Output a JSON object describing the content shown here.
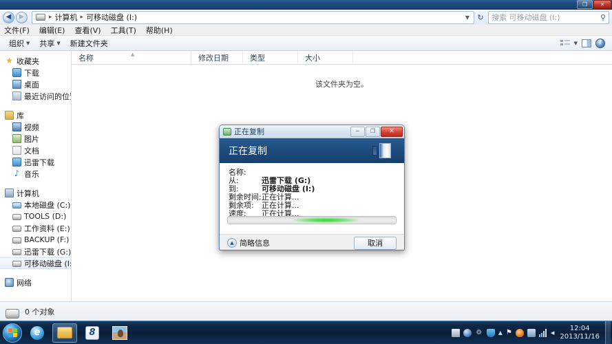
{
  "window": {
    "title": "",
    "controls": {
      "restore": "❐",
      "close": "✕"
    }
  },
  "address": {
    "back_icon": "◀",
    "forward_icon": "▶",
    "drive_icon": "removable-drive-icon",
    "crumbs": [
      "计算机",
      "可移动磁盘 (I:)"
    ],
    "separator": "▸",
    "dropdown_caret": "▼",
    "refresh_icon": "↻"
  },
  "search": {
    "placeholder": "搜索 可移动磁盘 (I:)",
    "icon": "⚲"
  },
  "menubar": {
    "items": [
      "文件(F)",
      "编辑(E)",
      "查看(V)",
      "工具(T)",
      "帮助(H)"
    ]
  },
  "toolbar": {
    "organize": "组织",
    "share": "共享",
    "new_folder": "新建文件夹",
    "caret": "▼",
    "help_glyph": "?"
  },
  "sidebar": {
    "groups": [
      {
        "header": "收藏夹",
        "items": [
          "下载",
          "桌面",
          "最近访问的位置"
        ]
      },
      {
        "header": "库",
        "items": [
          "视频",
          "图片",
          "文档",
          "迅雷下载",
          "音乐"
        ]
      },
      {
        "header": "计算机",
        "items": [
          "本地磁盘 (C:)",
          "TOOLS (D:)",
          "工作资料 (E:)",
          "BACKUP (F:)",
          "迅雷下载 (G:)",
          "可移动磁盘 (I:)"
        ],
        "selected": "可移动磁盘 (I:)"
      },
      {
        "header": "网络",
        "items": []
      }
    ]
  },
  "filelist": {
    "columns": [
      "名称",
      "修改日期",
      "类型",
      "大小"
    ],
    "sort_arrow": "▲",
    "empty_message": "该文件夹为空。"
  },
  "statusbar": {
    "text": "0 个对象"
  },
  "dialog": {
    "titlebar_text": "正在复制",
    "banner_text": "正在复制",
    "controls": {
      "minimize": "─",
      "maximize": "❐",
      "close": "✕"
    },
    "rows": [
      {
        "label": "名称:",
        "value": "",
        "bold": false
      },
      {
        "label": "从:",
        "value": "迅雷下载 (G:)",
        "bold": true
      },
      {
        "label": "到:",
        "value": "可移动磁盘 (I:)",
        "bold": true
      },
      {
        "label": "剩余时间:",
        "value": "正在计算...",
        "bold": false
      },
      {
        "label": "剩余项:",
        "value": "正在计算...",
        "bold": false
      },
      {
        "label": "速度:",
        "value": "正在计算...",
        "bold": false
      }
    ],
    "progress": {
      "indeterminate": true,
      "marquee_position_pct": 58,
      "color": "#2fd92f"
    },
    "collapse_label": "简略信息",
    "collapse_caret": "▲",
    "cancel_label": "取消"
  },
  "taskbar": {
    "start_label": "start-orb",
    "tasks": [
      "internet-explorer",
      "windows-explorer",
      "eight-app",
      "photo-viewer"
    ],
    "ie_glyph": "e",
    "eight_glyph": "8",
    "tray": {
      "caret": "▲",
      "flag_glyph": "⚑",
      "speaker_glyph": "◂",
      "time": "12:04",
      "date": "2013/11/16"
    }
  },
  "colors": {
    "accent_blue": "#1d4a7c",
    "progress_green": "#2fd92f",
    "close_red": "#c1352a",
    "titlebar_gradient_top": "#2c5c96"
  }
}
